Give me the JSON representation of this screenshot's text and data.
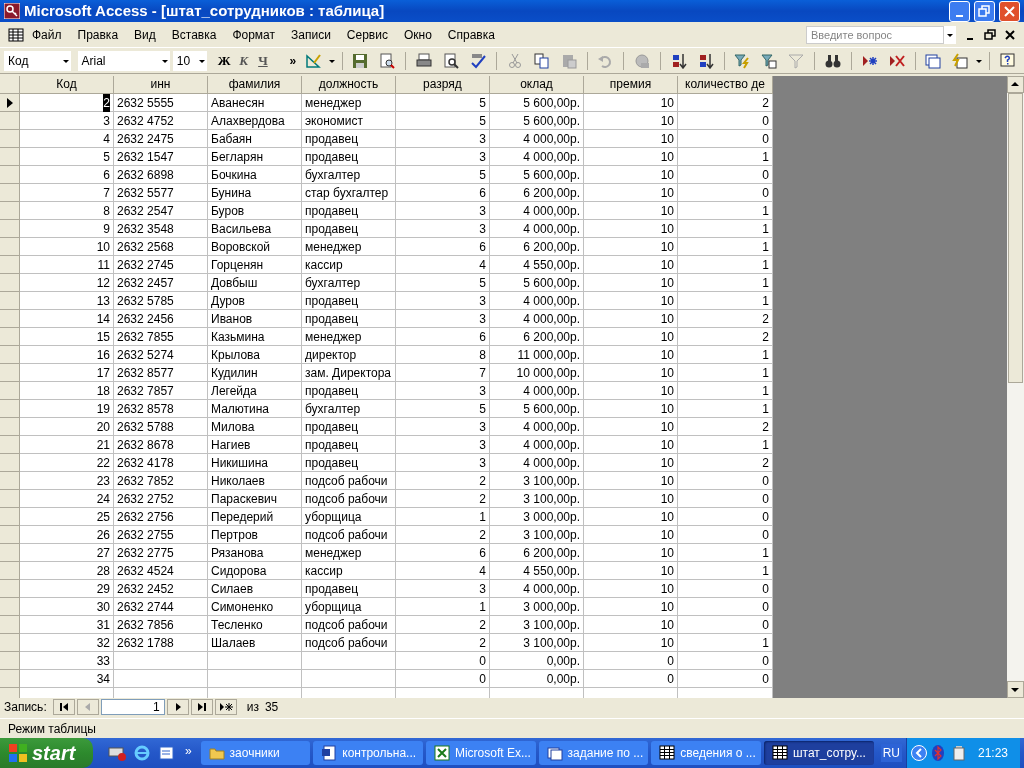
{
  "window": {
    "title": "Microsoft Access - [штат_сотрудников : таблица]"
  },
  "menu": [
    {
      "label": "Файл"
    },
    {
      "label": "Правка"
    },
    {
      "label": "Вид"
    },
    {
      "label": "Вставка"
    },
    {
      "label": "Формат"
    },
    {
      "label": "Записи"
    },
    {
      "label": "Сервис"
    },
    {
      "label": "Окно"
    },
    {
      "label": "Справка"
    }
  ],
  "help_search": {
    "placeholder": "Введите вопрос"
  },
  "formatting": {
    "field": "Код",
    "font": "Arial",
    "size": "10",
    "bold": "Ж",
    "italic": "К",
    "underline": "Ч",
    "more": "»"
  },
  "table": {
    "columns": [
      "Код",
      "инн",
      "фамилия",
      "должность",
      "разряд",
      "оклад",
      "премия",
      "количество де"
    ],
    "rows": [
      {
        "selected": true,
        "cells": [
          "2",
          "2632 5555",
          "Аванесян",
          "менеджер",
          "5",
          "5 600,00р.",
          "10",
          "2"
        ]
      },
      {
        "selected": false,
        "cells": [
          "3",
          "2632 4752",
          "Алахвердова",
          "экономист",
          "5",
          "5 600,00р.",
          "10",
          "0"
        ]
      },
      {
        "selected": false,
        "cells": [
          "4",
          "2632 2475",
          "Бабаян",
          "продавец",
          "3",
          "4 000,00р.",
          "10",
          "0"
        ]
      },
      {
        "selected": false,
        "cells": [
          "5",
          "2632 1547",
          "Бегларян",
          "продавец",
          "3",
          "4 000,00р.",
          "10",
          "1"
        ]
      },
      {
        "selected": false,
        "cells": [
          "6",
          "2632 6898",
          "Бочкина",
          "бухгалтер",
          "5",
          "5 600,00р.",
          "10",
          "0"
        ]
      },
      {
        "selected": false,
        "cells": [
          "7",
          "2632 5577",
          "Бунина",
          "стар бухгалтер",
          "6",
          "6 200,00р.",
          "10",
          "0"
        ]
      },
      {
        "selected": false,
        "cells": [
          "8",
          "2632 2547",
          "Буров",
          "продавец",
          "3",
          "4 000,00р.",
          "10",
          "1"
        ]
      },
      {
        "selected": false,
        "cells": [
          "9",
          "2632 3548",
          "Васильева",
          "продавец",
          "3",
          "4 000,00р.",
          "10",
          "1"
        ]
      },
      {
        "selected": false,
        "cells": [
          "10",
          "2632 2568",
          "Воровской",
          "менеджер",
          "6",
          "6 200,00р.",
          "10",
          "1"
        ]
      },
      {
        "selected": false,
        "cells": [
          "11",
          "2632 2745",
          "Горценян",
          "кассир",
          "4",
          "4 550,00р.",
          "10",
          "1"
        ]
      },
      {
        "selected": false,
        "cells": [
          "12",
          "2632 2457",
          "Довбыш",
          "бухгалтер",
          "5",
          "5 600,00р.",
          "10",
          "1"
        ]
      },
      {
        "selected": false,
        "cells": [
          "13",
          "2632 5785",
          "Дуров",
          "продавец",
          "3",
          "4 000,00р.",
          "10",
          "1"
        ]
      },
      {
        "selected": false,
        "cells": [
          "14",
          "2632 2456",
          "Иванов",
          "продавец",
          "3",
          "4 000,00р.",
          "10",
          "2"
        ]
      },
      {
        "selected": false,
        "cells": [
          "15",
          "2632 7855",
          "Казьмина",
          "менеджер",
          "6",
          "6 200,00р.",
          "10",
          "2"
        ]
      },
      {
        "selected": false,
        "cells": [
          "16",
          "2632 5274",
          "Крылова",
          "директор",
          "8",
          "11 000,00р.",
          "10",
          "1"
        ]
      },
      {
        "selected": false,
        "cells": [
          "17",
          "2632 8577",
          "Кудилин",
          "зам. Директора",
          "7",
          "10 000,00р.",
          "10",
          "1"
        ]
      },
      {
        "selected": false,
        "cells": [
          "18",
          "2632 7857",
          "Легейда",
          "продавец",
          "3",
          "4 000,00р.",
          "10",
          "1"
        ]
      },
      {
        "selected": false,
        "cells": [
          "19",
          "2632 8578",
          "Малютина",
          "бухгалтер",
          "5",
          "5 600,00р.",
          "10",
          "1"
        ]
      },
      {
        "selected": false,
        "cells": [
          "20",
          "2632 5788",
          "Милова",
          "продавец",
          "3",
          "4 000,00р.",
          "10",
          "2"
        ]
      },
      {
        "selected": false,
        "cells": [
          "21",
          "2632 8678",
          "Нагиев",
          "продавец",
          "3",
          "4 000,00р.",
          "10",
          "1"
        ]
      },
      {
        "selected": false,
        "cells": [
          "22",
          "2632 4178",
          "Никишина",
          "продавец",
          "3",
          "4 000,00р.",
          "10",
          "2"
        ]
      },
      {
        "selected": false,
        "cells": [
          "23",
          "2632 7852",
          "Николаев",
          "подсоб рабочи",
          "2",
          "3 100,00р.",
          "10",
          "0"
        ]
      },
      {
        "selected": false,
        "cells": [
          "24",
          "2632 2752",
          "Параскевич",
          "подсоб рабочи",
          "2",
          "3 100,00р.",
          "10",
          "0"
        ]
      },
      {
        "selected": false,
        "cells": [
          "25",
          "2632 2756",
          "Передерий",
          "уборщица",
          "1",
          "3 000,00р.",
          "10",
          "0"
        ]
      },
      {
        "selected": false,
        "cells": [
          "26",
          "2632 2755",
          "Пертров",
          "подсоб рабочи",
          "2",
          "3 100,00р.",
          "10",
          "0"
        ]
      },
      {
        "selected": false,
        "cells": [
          "27",
          "2632 2775",
          "Рязанова",
          "менеджер",
          "6",
          "6 200,00р.",
          "10",
          "1"
        ]
      },
      {
        "selected": false,
        "cells": [
          "28",
          "2632 4524",
          "Сидорова",
          "кассир",
          "4",
          "4 550,00р.",
          "10",
          "1"
        ]
      },
      {
        "selected": false,
        "cells": [
          "29",
          "2632 2452",
          "Силаев",
          "продавец",
          "3",
          "4 000,00р.",
          "10",
          "0"
        ]
      },
      {
        "selected": false,
        "cells": [
          "30",
          "2632 2744",
          "Симоненко",
          "уборщица",
          "1",
          "3 000,00р.",
          "10",
          "0"
        ]
      },
      {
        "selected": false,
        "cells": [
          "31",
          "2632 7856",
          "Тесленко",
          "подсоб рабочи",
          "2",
          "3 100,00р.",
          "10",
          "0"
        ]
      },
      {
        "selected": false,
        "cells": [
          "32",
          "2632 1788",
          "Шалаев",
          "подсоб рабочи",
          "2",
          "3 100,00р.",
          "10",
          "1"
        ]
      },
      {
        "selected": false,
        "cells": [
          "33",
          null,
          null,
          null,
          "0",
          "0,00р.",
          "0",
          "0"
        ]
      },
      {
        "selected": false,
        "cells": [
          "34",
          null,
          null,
          null,
          "0",
          "0,00р.",
          "0",
          "0"
        ]
      }
    ]
  },
  "navigator": {
    "label": "Запись:",
    "value": "1",
    "of": "из",
    "total": "35"
  },
  "status_bar": "Режим таблицы",
  "taskbar": {
    "start": "start",
    "tasks": [
      {
        "label": "заочники",
        "kind": "folder",
        "selected": false
      },
      {
        "label": "контрольна...",
        "kind": "word",
        "selected": false
      },
      {
        "label": "Microsoft Ex...",
        "kind": "excel",
        "selected": false
      },
      {
        "label": "задание по ...",
        "kind": "form",
        "selected": false
      },
      {
        "label": "сведения о ...",
        "kind": "table",
        "selected": false
      },
      {
        "label": "штат_сотру...",
        "kind": "table",
        "selected": true
      }
    ],
    "more": "»",
    "language": "RU",
    "time": "21:23"
  }
}
